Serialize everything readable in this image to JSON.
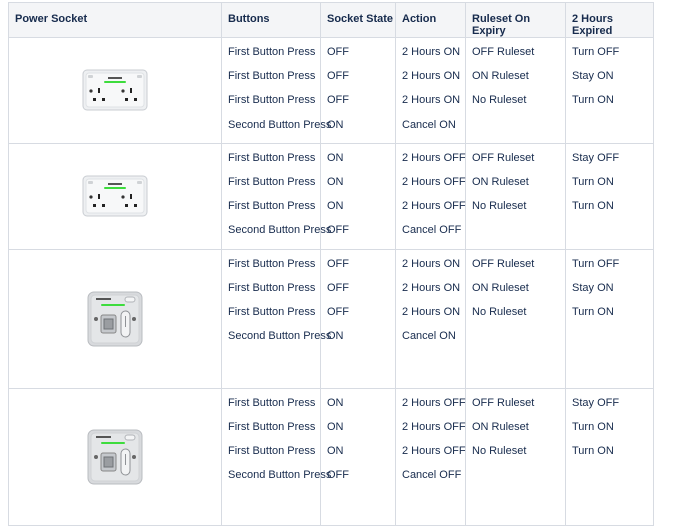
{
  "headers": {
    "socket": "Power Socket",
    "buttons": "Buttons",
    "state": "Socket State",
    "action": "Action",
    "ruleset": "Ruleset On Expiry",
    "expired": "2 Hours Expired"
  },
  "rows": [
    {
      "socket_type": "double-socket-icon",
      "buttons": [
        "First Button Press",
        "First Button Press",
        "First Button Press",
        "Second Button Press"
      ],
      "state": [
        "OFF",
        "OFF",
        "OFF",
        "ON"
      ],
      "action": [
        "2 Hours ON",
        "2 Hours ON",
        "2 Hours ON",
        "Cancel ON"
      ],
      "ruleset": [
        "OFF Ruleset",
        "ON Ruleset",
        "No Ruleset"
      ],
      "expired": [
        "Turn OFF",
        "Stay ON",
        "Turn ON"
      ]
    },
    {
      "socket_type": "double-socket-icon",
      "buttons": [
        "First Button Press",
        "First Button Press",
        "First Button Press",
        "Second Button Press"
      ],
      "state": [
        "ON",
        "ON",
        "ON",
        "OFF"
      ],
      "action": [
        "2 Hours OFF",
        "2 Hours OFF",
        "2 Hours OFF",
        "Cancel OFF"
      ],
      "ruleset": [
        "OFF Ruleset",
        "ON Ruleset",
        "No Ruleset"
      ],
      "expired": [
        "Stay OFF",
        "Turn ON",
        "Turn ON"
      ]
    },
    {
      "socket_type": "fused-spur-icon",
      "buttons": [
        "First Button Press",
        "First Button Press",
        "First Button Press",
        "Second Button Press"
      ],
      "state": [
        "OFF",
        "OFF",
        "OFF",
        "ON"
      ],
      "action": [
        "2 Hours ON",
        "2 Hours ON",
        "2 Hours ON",
        "Cancel ON"
      ],
      "ruleset": [
        "OFF Ruleset",
        "ON Ruleset",
        "No Ruleset"
      ],
      "expired": [
        "Turn OFF",
        "Stay ON",
        "Turn ON"
      ]
    },
    {
      "socket_type": "fused-spur-icon",
      "buttons": [
        "First Button Press",
        "First Button Press",
        "First Button Press",
        "Second Button Press"
      ],
      "state": [
        "ON",
        "ON",
        "ON",
        "OFF"
      ],
      "action": [
        "2 Hours OFF",
        "2 Hours OFF",
        "2 Hours OFF",
        "Cancel OFF"
      ],
      "ruleset": [
        "OFF Ruleset",
        "ON Ruleset",
        "No Ruleset"
      ],
      "expired": [
        "Stay OFF",
        "Turn ON",
        "Turn ON"
      ]
    }
  ]
}
